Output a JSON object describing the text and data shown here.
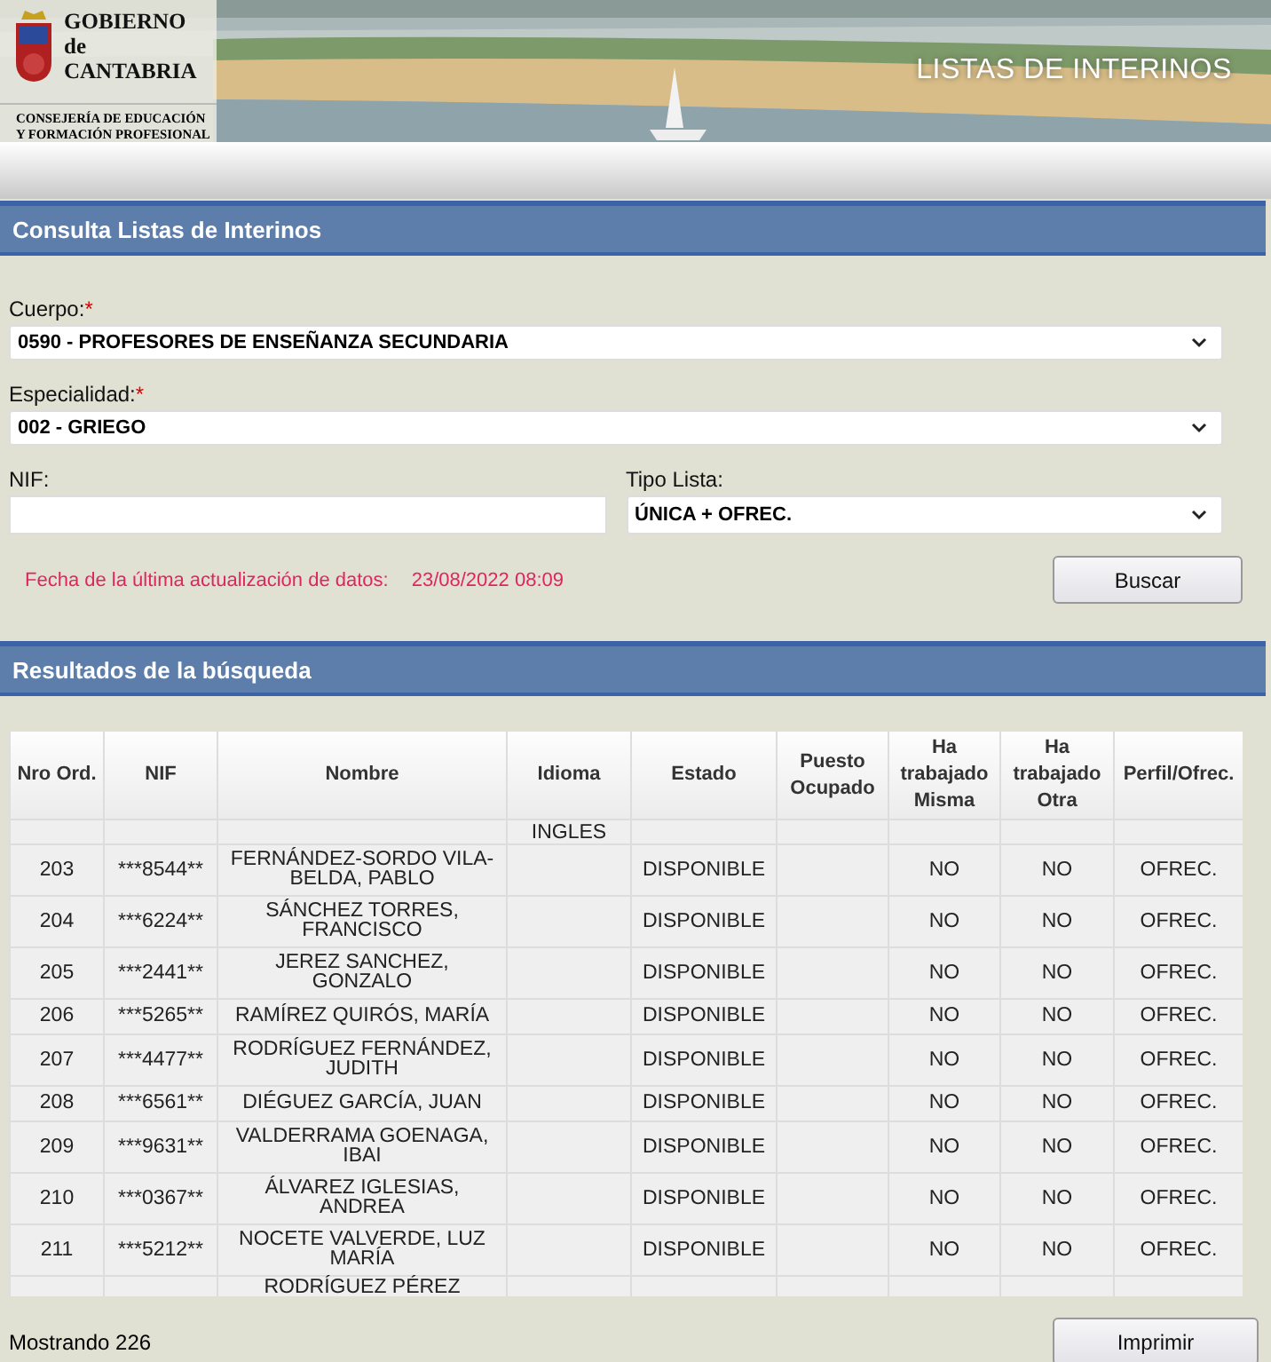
{
  "header": {
    "logo_title": [
      "GOBIERNO",
      "de",
      "CANTABRIA"
    ],
    "logo_subtitle": [
      "CONSEJERÍA DE EDUCACIÓN",
      "Y FORMACIÓN PROFESIONAL"
    ],
    "title": "LISTAS DE INTERINOS"
  },
  "search_section": {
    "title": "Consulta Listas de Interinos",
    "field_rows": [
      [
        {
          "kind": "select",
          "label": "Cuerpo:",
          "required_mark": "*",
          "value": "0590 - PROFESORES DE ENSEÑANZA SECUNDARIA"
        }
      ],
      [
        {
          "kind": "select",
          "label": "Especialidad:",
          "required_mark": "*",
          "value": "002 - GRIEGO"
        }
      ],
      [
        {
          "kind": "text",
          "label": "NIF:"
        },
        {
          "kind": "select",
          "label": "Tipo Lista:",
          "value": "ÚNICA + OFREC."
        }
      ]
    ],
    "update_label": "Fecha de la última actualización de datos:",
    "update_value": "23/08/2022 08:09",
    "button": "Buscar"
  },
  "results_section": {
    "title": "Resultados de la búsqueda",
    "table": {
      "columns": [
        "Nro Ord.",
        "NIF",
        "Nombre",
        "Idioma",
        "Estado",
        "Puesto Ocupado",
        "Ha trabajado Misma",
        "Ha trabajado Otra",
        "Perfil/Ofrec."
      ],
      "rows": [
        {
          "kind": "partial_top",
          "cells": [
            "",
            "",
            "",
            "INGLES",
            "",
            "",
            "",
            "",
            ""
          ]
        },
        {
          "kind": "full",
          "cells": [
            "203",
            "***8544**",
            "FERNÁNDEZ-SORDO VILA-BELDA, PABLO",
            "",
            "DISPONIBLE",
            "",
            "NO",
            "NO",
            "OFREC."
          ]
        },
        {
          "kind": "full",
          "cells": [
            "204",
            "***6224**",
            "SÁNCHEZ TORRES, FRANCISCO",
            "",
            "DISPONIBLE",
            "",
            "NO",
            "NO",
            "OFREC."
          ]
        },
        {
          "kind": "full",
          "cells": [
            "205",
            "***2441**",
            "JEREZ SANCHEZ, GONZALO",
            "",
            "DISPONIBLE",
            "",
            "NO",
            "NO",
            "OFREC."
          ]
        },
        {
          "kind": "full",
          "cells": [
            "206",
            "***5265**",
            "RAMÍREZ QUIRÓS, MARÍA",
            "",
            "DISPONIBLE",
            "",
            "NO",
            "NO",
            "OFREC."
          ]
        },
        {
          "kind": "full",
          "cells": [
            "207",
            "***4477**",
            "RODRÍGUEZ FERNÁNDEZ, JUDITH",
            "",
            "DISPONIBLE",
            "",
            "NO",
            "NO",
            "OFREC."
          ]
        },
        {
          "kind": "full",
          "cells": [
            "208",
            "***6561**",
            "DIÉGUEZ GARCÍA, JUAN",
            "",
            "DISPONIBLE",
            "",
            "NO",
            "NO",
            "OFREC."
          ]
        },
        {
          "kind": "full",
          "cells": [
            "209",
            "***9631**",
            "VALDERRAMA GOENAGA, IBAI",
            "",
            "DISPONIBLE",
            "",
            "NO",
            "NO",
            "OFREC."
          ]
        },
        {
          "kind": "full",
          "cells": [
            "210",
            "***0367**",
            "ÁLVAREZ IGLESIAS, ANDREA",
            "",
            "DISPONIBLE",
            "",
            "NO",
            "NO",
            "OFREC."
          ]
        },
        {
          "kind": "full",
          "cells": [
            "211",
            "***5212**",
            "NOCETE VALVERDE, LUZ MARÍA",
            "",
            "DISPONIBLE",
            "",
            "NO",
            "NO",
            "OFREC."
          ]
        },
        {
          "kind": "partial_bottom",
          "cells": [
            "",
            "",
            "RODRÍGUEZ PÉREZ",
            "",
            "",
            "",
            "",
            "",
            ""
          ]
        }
      ]
    },
    "count": "Mostrando 226",
    "button": "Imprimir"
  }
}
